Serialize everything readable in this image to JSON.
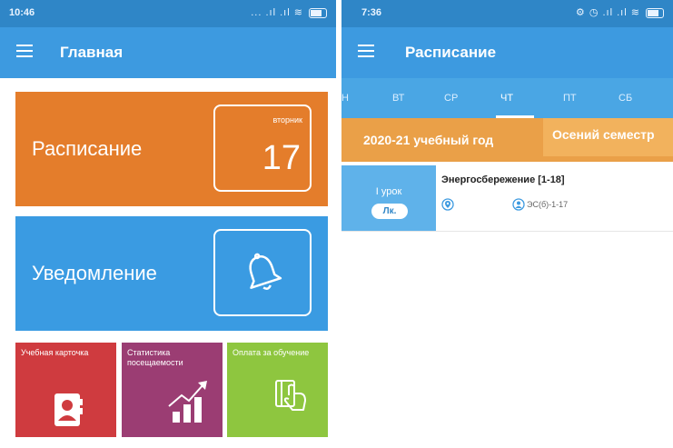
{
  "left": {
    "status": {
      "time": "10:46",
      "signal": "... .ıl .ıl"
    },
    "appbar": {
      "title": "Главная"
    },
    "schedule_tile": {
      "label": "Расписание",
      "weekday": "вторник",
      "day": "17"
    },
    "notice_tile": {
      "label": "Уведомление"
    },
    "small_tiles": [
      {
        "label": "Учебная карточка"
      },
      {
        "label": "Статистика посещаемости"
      },
      {
        "label": "Оплата за обучение"
      }
    ]
  },
  "right": {
    "status": {
      "time": "7:36",
      "signal": "⚙ ◷ .ıl .ıl"
    },
    "appbar": {
      "title": "Расписание"
    },
    "days": [
      {
        "label": "Н"
      },
      {
        "label": "ВТ"
      },
      {
        "label": "СР"
      },
      {
        "label": "ЧТ"
      },
      {
        "label": "ПТ"
      },
      {
        "label": "СБ"
      }
    ],
    "active_day": "ЧТ",
    "academic_year": "2020-21 учебный год",
    "semester": "Осений семестр",
    "lesson": {
      "number": "I урок",
      "type": "Лк.",
      "title": "Энергосбережение [1-18]",
      "group": "ЭС(б)-1-17"
    }
  },
  "colors": {
    "statusbar": "#2f86c7",
    "appbar": "#3d9ae0",
    "schedule": "#e47d2b",
    "notice": "#3a9be2",
    "card": "#cf3b3f",
    "stats": "#9b3d73",
    "pay": "#8ec63f",
    "year_bar": "#eaa048"
  }
}
